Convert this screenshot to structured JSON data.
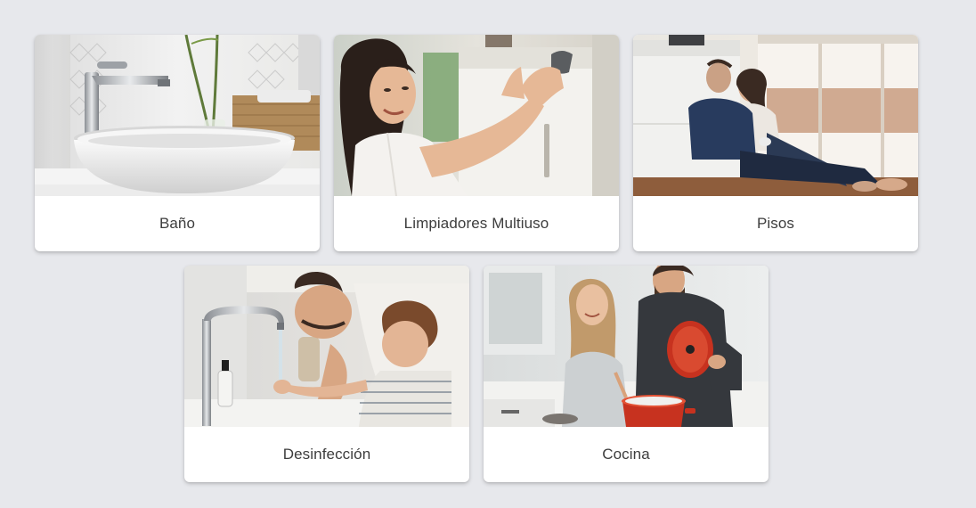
{
  "categories": [
    {
      "label": "Baño",
      "image": "bathroom-sink-photo"
    },
    {
      "label": "Limpiadores Multiuso",
      "image": "woman-cleaning-cabinet-photo"
    },
    {
      "label": "Pisos",
      "image": "couple-sitting-on-floor-photo"
    },
    {
      "label": "Desinfección",
      "image": "father-child-washing-hands-photo"
    },
    {
      "label": "Cocina",
      "image": "couple-cooking-kitchen-photo"
    }
  ],
  "colors": {
    "page_background": "#e7e8ec",
    "card_background": "#ffffff",
    "label_text": "#3d3d3d"
  }
}
